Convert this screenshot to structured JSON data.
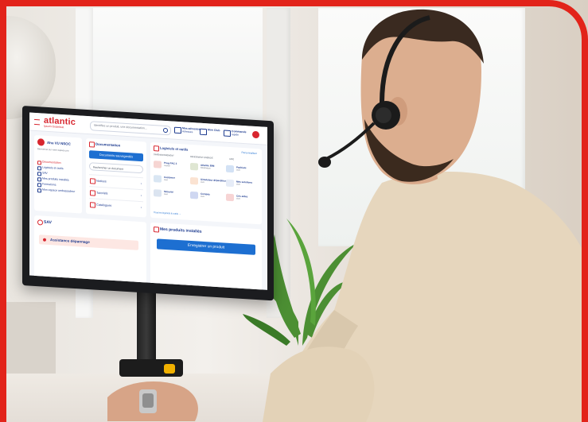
{
  "brand": {
    "name": "atlantic",
    "tagline": "Ipsum Ondelicat",
    "accent": "#d8262f",
    "blue": "#1d3b8f"
  },
  "topbar": {
    "search_placeholder": "Identifiez un produit, une documentation...",
    "item1_title": "Mes adresses",
    "item1_sub": "Adresses",
    "item2_title": "Mon Club",
    "item3_title": "Commande",
    "item3_sub": "rapide"
  },
  "sidebar": {
    "user_name": "Ahu VU NSOC",
    "welcome": "Bienvenue sur votre espace pro",
    "items": [
      "Documentation",
      "Logiciels et outils",
      "SAV",
      "Mes produits installés",
      "Formations",
      "Mon espace ambassadeur"
    ]
  },
  "documentation": {
    "title": "Documentation",
    "button": "Documents sauvegardés",
    "search_placeholder": "Rechercher un document",
    "items": [
      "Notices",
      "Tutoriels",
      "Catalogues"
    ]
  },
  "logiciels": {
    "title": "Logiciels et outils",
    "customize": "Personnaliser",
    "tabs": [
      "DIMENSIONNEMENT",
      "RENDEMENT ENERGIE",
      "AIDE"
    ],
    "tiles": [
      {
        "name": "Prog PAC 3",
        "sub": "Logiciel"
      },
      {
        "name": "Atlantic BIM",
        "sub": "Bibliothèque"
      },
      {
        "name": "PaclCalc",
        "sub": "Outil"
      },
      {
        "name": "Customer",
        "sub": "Outil"
      },
      {
        "name": "Simulateur déperdition",
        "sub": "Outil"
      },
      {
        "name": "Mes solutions",
        "sub": "Outil"
      },
      {
        "name": "Sécurité",
        "sub": "Outil"
      },
      {
        "name": "Compas",
        "sub": "Outil"
      },
      {
        "name": "Cris aides",
        "sub": "Outil"
      }
    ],
    "see_all": "Tous les logiciels & outils →"
  },
  "sav": {
    "title": "SAV",
    "button": "Assistance dépannage"
  },
  "produits": {
    "title": "Mes produits installés",
    "button": "Enregistrer un produit"
  }
}
